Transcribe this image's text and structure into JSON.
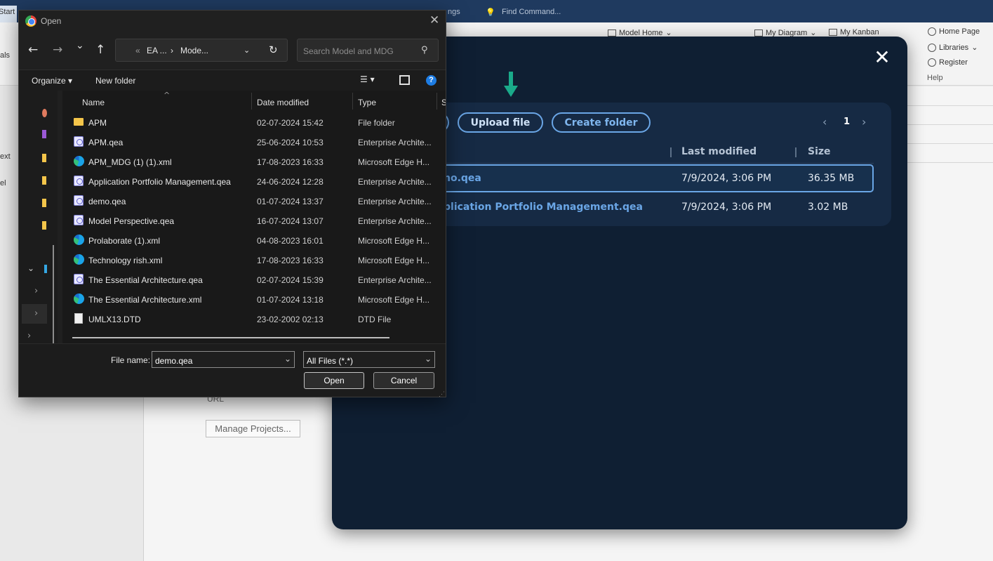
{
  "ea": {
    "start_tab": "Start",
    "topbar": {
      "settings_fragment": "ngs",
      "find_command": "Find Command..."
    },
    "ribbon": {
      "model_home": "Model Home",
      "my_diagram": "My Diagram",
      "my_kanban": "My Kanban",
      "home_page": "Home Page",
      "libraries": "Libraries",
      "register": "Register",
      "help_group": "Help"
    },
    "left_fragments": {
      "a": "als",
      "b": "ext",
      "c": "el"
    },
    "url_label": "URL",
    "manage_projects": "Manage Projects..."
  },
  "modal": {
    "close_glyph": "✕",
    "upload_label": "Upload file",
    "create_label": "Create folder",
    "pager": {
      "prev": "‹",
      "page": "1",
      "next": "›"
    },
    "columns": {
      "modified": "Last modified",
      "size": "Size"
    },
    "rows": [
      {
        "name": "no.qea",
        "modified": "7/9/2024, 3:06 PM",
        "size": "36.35 MB"
      },
      {
        "name": "plication Portfolio Management.qea",
        "modified": "7/9/2024, 3:06 PM",
        "size": "3.02 MB"
      }
    ],
    "accent": "#6aa6e6",
    "arrow_color": "#1aaa8a"
  },
  "dialog": {
    "title": "Open",
    "close_glyph": "✕",
    "nav": {
      "back": "←",
      "forward": "→",
      "recent": "⌄",
      "up": "↑"
    },
    "address": {
      "prefix": "«",
      "crumb1": "EA ...",
      "sep": "›",
      "crumb2": "Mode...",
      "refresh": "↻"
    },
    "search_placeholder": "Search Model and MDG",
    "toolbar": {
      "organize": "Organize ▾",
      "new_folder": "New folder",
      "help": "?"
    },
    "columns": {
      "name": "Name",
      "date": "Date modified",
      "type": "Type",
      "size_stub": "S"
    },
    "files": [
      {
        "name": "APM",
        "date": "02-07-2024 15:42",
        "type": "File folder",
        "icon": "folder-icon"
      },
      {
        "name": "APM.qea",
        "date": "25-06-2024 10:53",
        "type": "Enterprise Archite...",
        "icon": "qea-file-icon"
      },
      {
        "name": "APM_MDG (1) (1).xml",
        "date": "17-08-2023 16:33",
        "type": "Microsoft Edge H...",
        "icon": "edge-icon"
      },
      {
        "name": "Application Portfolio Management.qea",
        "date": "24-06-2024 12:28",
        "type": "Enterprise Archite...",
        "icon": "qea-file-icon"
      },
      {
        "name": "demo.qea",
        "date": "01-07-2024 13:37",
        "type": "Enterprise Archite...",
        "icon": "qea-file-icon"
      },
      {
        "name": "Model Perspective.qea",
        "date": "16-07-2024 13:07",
        "type": "Enterprise Archite...",
        "icon": "qea-file-icon"
      },
      {
        "name": "Prolaborate (1).xml",
        "date": "04-08-2023 16:01",
        "type": "Microsoft Edge H...",
        "icon": "edge-icon"
      },
      {
        "name": "Technology rish.xml",
        "date": "17-08-2023 16:33",
        "type": "Microsoft Edge H...",
        "icon": "edge-icon"
      },
      {
        "name": "The Essential Architecture.qea",
        "date": "02-07-2024 15:39",
        "type": "Enterprise Archite...",
        "icon": "qea-file-icon"
      },
      {
        "name": "The Essential Architecture.xml",
        "date": "01-07-2024 13:18",
        "type": "Microsoft Edge H...",
        "icon": "edge-icon"
      },
      {
        "name": "UMLX13.DTD",
        "date": "23-02-2002 02:13",
        "type": "DTD File",
        "icon": "file-icon"
      }
    ],
    "file_name_label": "File name:",
    "file_name_value": "demo.qea",
    "filter_value": "All Files (*.*)",
    "open_label": "Open",
    "cancel_label": "Cancel"
  }
}
